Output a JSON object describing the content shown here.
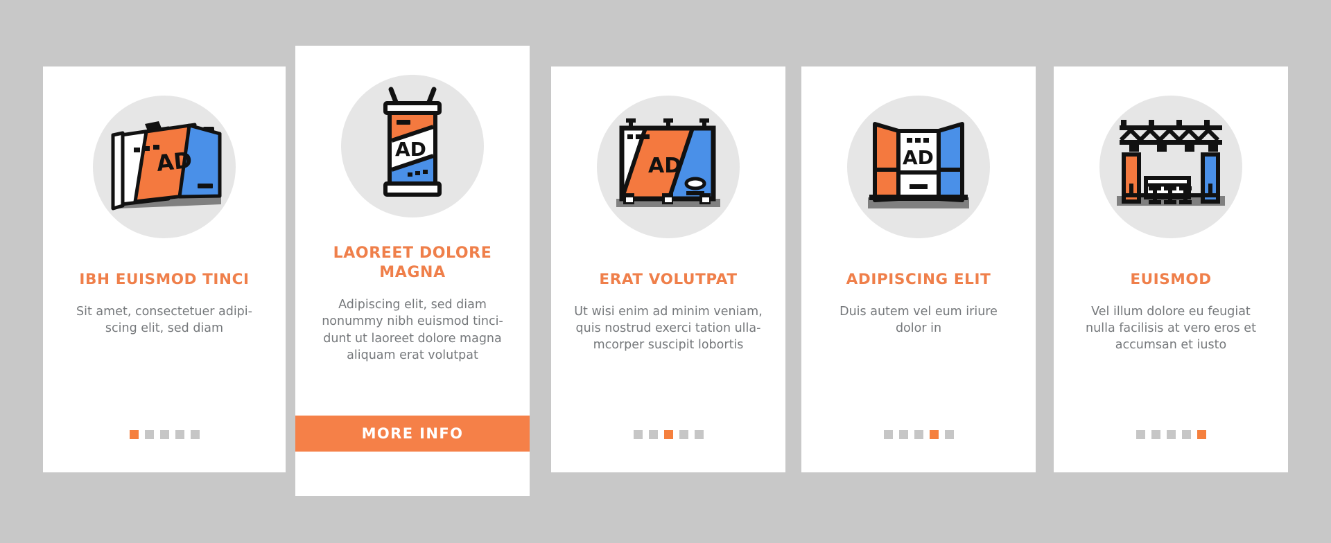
{
  "theme": {
    "background": "#c8c8c8",
    "card_background": "#ffffff",
    "accent_orange": "#ef7f4a",
    "button_orange": "#f58048",
    "icon_orange": "#f4793f",
    "icon_blue": "#4a90e8",
    "icon_gray": "#808080",
    "icon_disc": "#e6e6e6",
    "body_text": "#75787b",
    "dot_inactive": "#c6c6c6",
    "dot_active": "#f5803e",
    "outline": "#111111"
  },
  "cards": [
    {
      "title": "IBH EUISMOD TINCI",
      "body": "Sit amet, consectetuer adipi-\nscing elit, sed diam",
      "icon": "curved-banner-wall-ad-icon",
      "icon_label": "AD",
      "dots": {
        "count": 5,
        "active_index": 0
      },
      "has_button": false
    },
    {
      "title": "LAOREET DOLORE\nMAGNA",
      "body": "Adipiscing elit, sed diam\nnonummy nibh euismod tinci-\ndunt ut laoreet dolore magna\naliquam erat volutpat",
      "icon": "vertical-pylon-banner-ad-icon",
      "icon_label": "AD",
      "dots": {
        "count": 5,
        "active_index": 1
      },
      "has_button": true,
      "button_label": "MORE INFO"
    },
    {
      "title": "ERAT VOLUTPAT",
      "body": "Ut wisi enim ad minim veniam,\nquis nostrud exerci tation ulla-\nmcorper suscipit lobortis",
      "icon": "flat-billboard-ad-icon",
      "icon_label": "AD",
      "dots": {
        "count": 5,
        "active_index": 2
      },
      "has_button": false
    },
    {
      "title": "ADIPISCING ELIT",
      "body": "Duis autem vel eum iriure\ndolor in",
      "icon": "trifold-exhibition-booth-ad-icon",
      "icon_label": "AD",
      "dots": {
        "count": 5,
        "active_index": 3
      },
      "has_button": false
    },
    {
      "title": "EUISMOD",
      "body": "Vel illum dolore eu feugiat\nnulla facilisis at vero eros et\naccumsan et iusto",
      "icon": "trade-show-truss-booth-icon",
      "icon_label": "",
      "dots": {
        "count": 5,
        "active_index": 4
      },
      "has_button": false
    }
  ]
}
